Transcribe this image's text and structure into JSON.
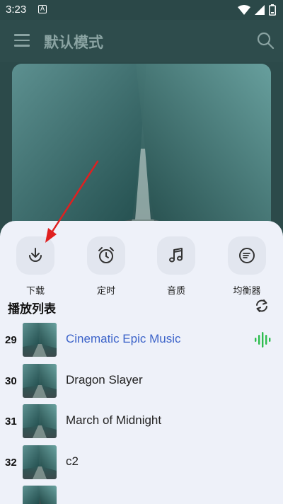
{
  "status_bar": {
    "time": "3:23",
    "app_icon_glyph": "A",
    "icons": [
      "wifi-icon",
      "signal-icon",
      "battery-icon"
    ]
  },
  "app_bar": {
    "title": "默认模式",
    "icons": [
      "menu-icon",
      "search-icon"
    ]
  },
  "cover_art": {
    "alt": "teal canyon landscape"
  },
  "actions": [
    {
      "label": "下载",
      "icon": "download-icon"
    },
    {
      "label": "定时",
      "icon": "alarm-clock-icon"
    },
    {
      "label": "音质",
      "icon": "music-note-icon"
    },
    {
      "label": "均衡器",
      "icon": "equalizer-icon"
    }
  ],
  "playlist": {
    "title": "播放列表",
    "icon": "repeat-icon",
    "tracks": [
      {
        "number": "29",
        "title": "Cinematic Epic Music",
        "active": true
      },
      {
        "number": "30",
        "title": "Dragon Slayer",
        "active": false
      },
      {
        "number": "31",
        "title": "March of Midnight",
        "active": false
      },
      {
        "number": "32",
        "title": "c2",
        "active": false
      }
    ]
  },
  "colors": {
    "background_dim": "#2c4a4a",
    "sheet": "#eef1f9",
    "active_track": "#3c63c9",
    "playing_indicator": "#2dbd4e",
    "annotation_arrow": "#e02020"
  }
}
